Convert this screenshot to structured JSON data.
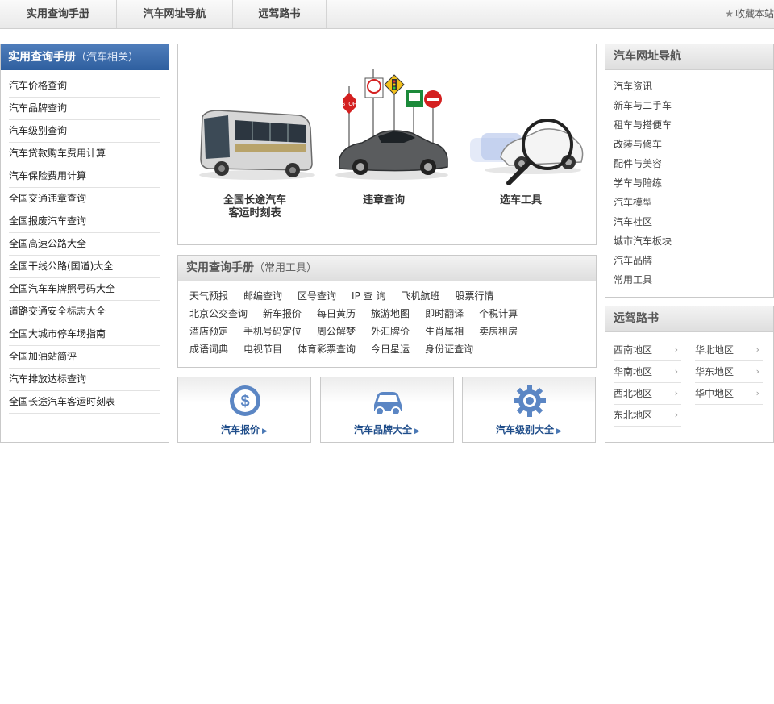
{
  "topnav": {
    "tabs": [
      "实用查询手册",
      "汽车网址导航",
      "远驾路书"
    ],
    "favorite": "收藏本站"
  },
  "left_panel": {
    "title": "实用查询手册",
    "subtitle": "（汽车相关）",
    "items": [
      "汽车价格查询",
      "汽车品牌查询",
      "汽车级别查询",
      "汽车贷款购车费用计算",
      "汽车保险费用计算",
      "全国交通违章查询",
      "全国报废汽车查询",
      "全国高速公路大全",
      "全国干线公路(国道)大全",
      "全国汽车车牌照号码大全",
      "道路交通安全标志大全",
      "全国大城市停车场指南",
      "全国加油站简评",
      "汽车排放达标查询",
      "全国长途汽车客运时刻表"
    ]
  },
  "banner": {
    "features": [
      {
        "line1": "全国长途汽车",
        "line2": "客运时刻表",
        "icon": "bus-icon"
      },
      {
        "line1": "违章查询",
        "line2": "",
        "icon": "traffic-signs-car-icon"
      },
      {
        "line1": "选车工具",
        "line2": "",
        "icon": "magnifier-car-icon"
      }
    ]
  },
  "tools": {
    "title": "实用查询手册",
    "subtitle": "（常用工具）",
    "rows": [
      [
        "天气预报",
        "邮编查询",
        "区号查询",
        "IP 查 询",
        "飞机航班",
        "股票行情"
      ],
      [
        "北京公交查询",
        "新车报价",
        "每日黄历",
        "旅游地图",
        "即时翻译",
        "个税计算"
      ],
      [
        "酒店预定",
        "手机号码定位",
        "周公解梦",
        "外汇牌价",
        "生肖属相",
        "卖房租房"
      ],
      [
        "成语词典",
        "电视节目",
        "体育彩票查询",
        "今日星运",
        "身份证查询"
      ]
    ]
  },
  "cards": [
    {
      "label": "汽车报价",
      "icon": "dollar-icon"
    },
    {
      "label": "汽车品牌大全",
      "icon": "car-icon"
    },
    {
      "label": "汽车级别大全",
      "icon": "gear-icon"
    }
  ],
  "nav_panel": {
    "title": "汽车网址导航",
    "items": [
      "汽车资讯",
      "新车与二手车",
      "租车与搭便车",
      "改装与修车",
      "配件与美容",
      "学车与陪练",
      "汽车模型",
      "汽车社区",
      "城市汽车板块",
      "汽车品牌",
      "常用工具"
    ]
  },
  "road_panel": {
    "title": "远驾路书",
    "regions": [
      "西南地区",
      "华北地区",
      "华南地区",
      "华东地区",
      "西北地区",
      "华中地区",
      "东北地区"
    ]
  },
  "colors": {
    "left_header": "#3a6aab",
    "card_label": "#1f4d8a",
    "icon_blue": "#5b86c4"
  }
}
